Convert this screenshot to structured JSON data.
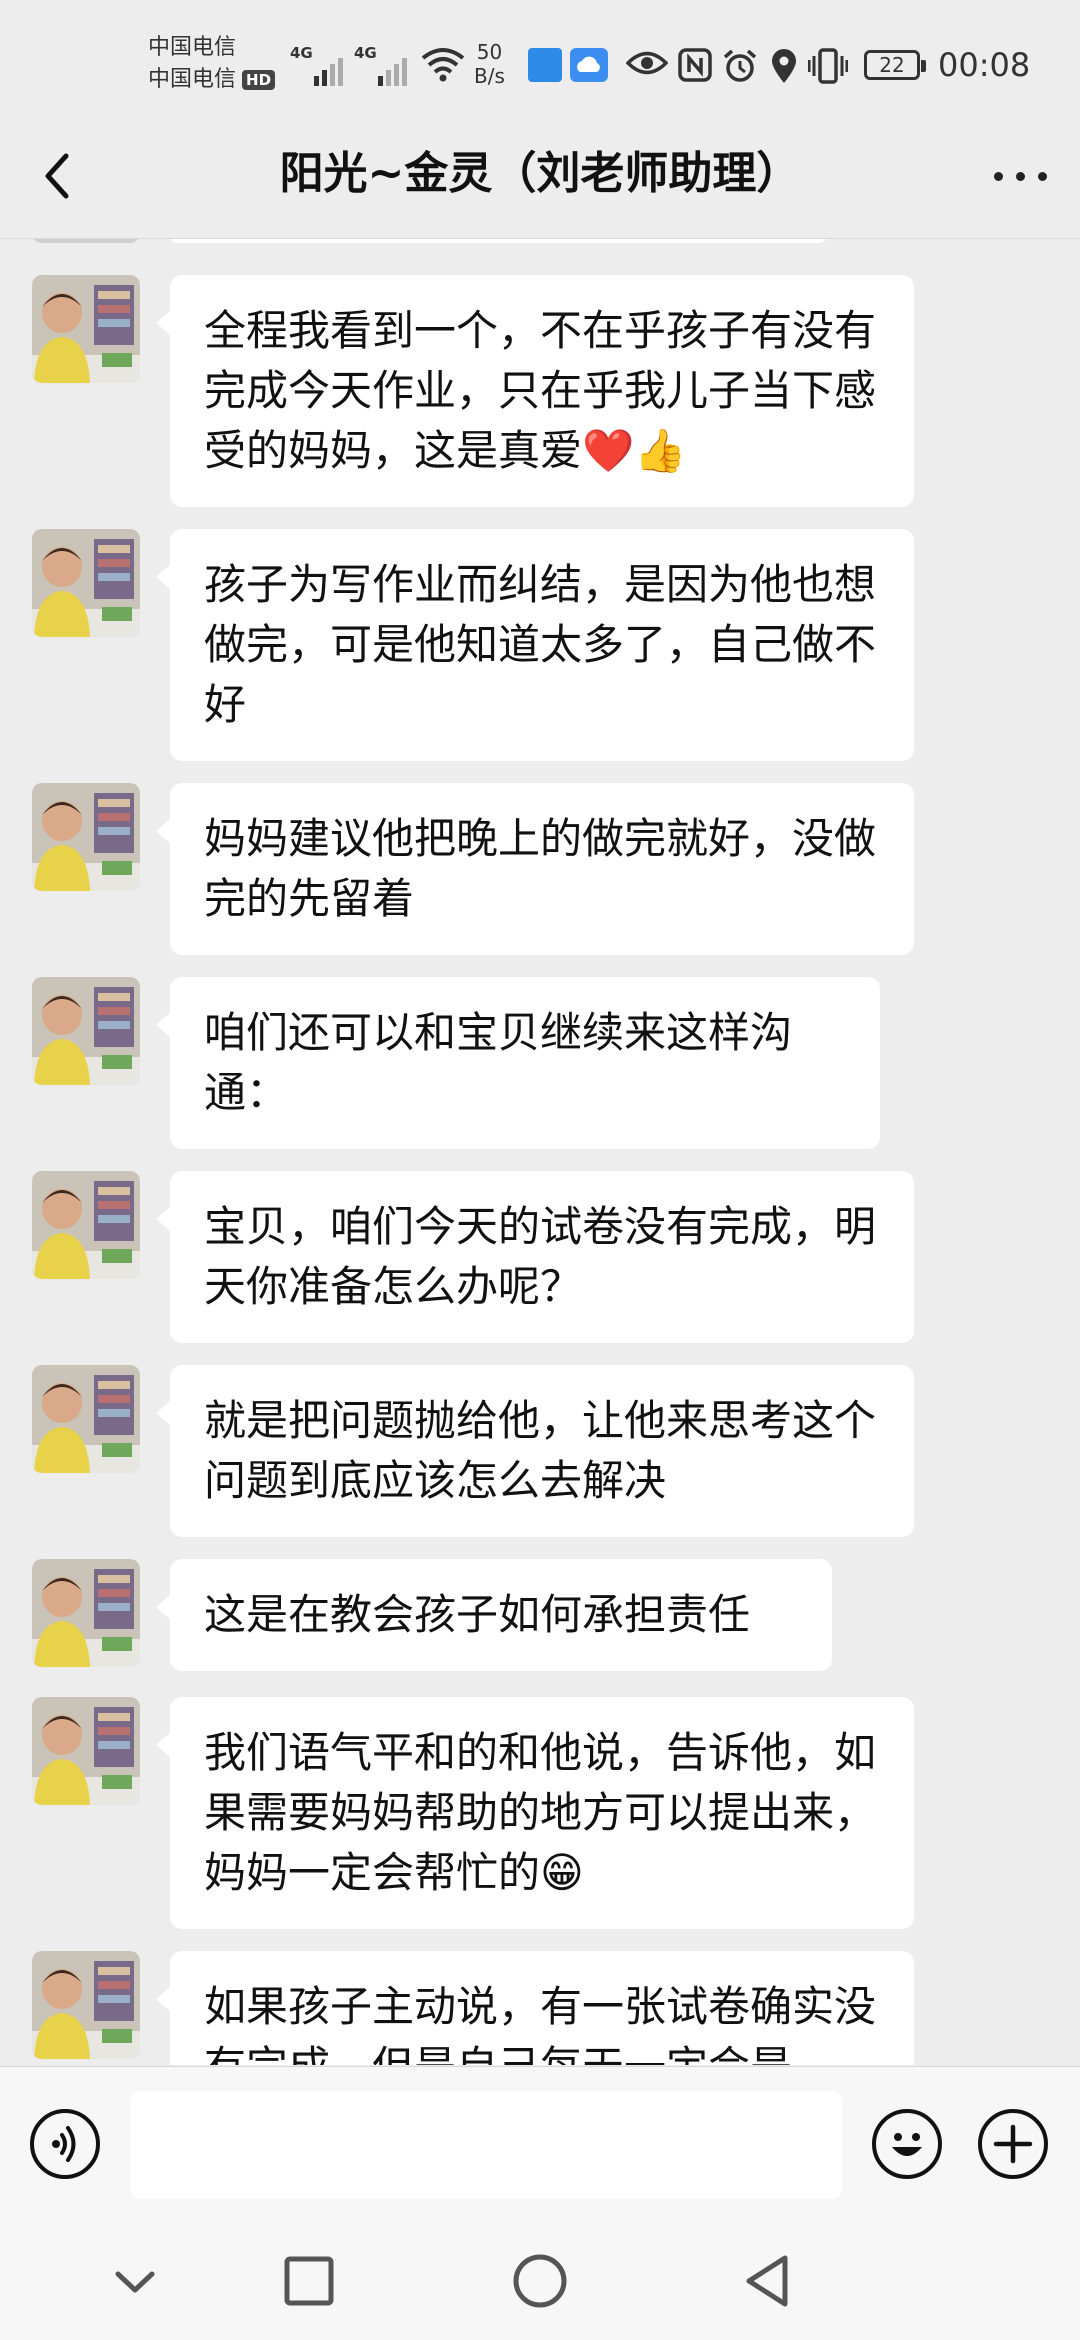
{
  "status_bar": {
    "carrier_1": "中国电信",
    "carrier_2": "中国电信",
    "hd_badge": "HD",
    "signal_1": "4G",
    "signal_2": "4G",
    "speed_value": "50",
    "speed_unit": "B/s",
    "battery": "22",
    "time": "00:08"
  },
  "header": {
    "title": "阳光~金灵（刘老师助理）"
  },
  "messages": [
    {
      "text": "全程我看到一个，不在乎孩子有没有完成今天作业，只在乎我儿子当下感受的妈妈，这是真爱❤️👍"
    },
    {
      "text": "孩子为写作业而纠结，是因为他也想做完，可是他知道太多了，自己做不好"
    },
    {
      "text": "妈妈建议他把晚上的做完就好，没做完的先留着"
    },
    {
      "text": "咱们还可以和宝贝继续来这样沟通："
    },
    {
      "text": "宝贝，咱们今天的试卷没有完成，明天你准备怎么办呢？"
    },
    {
      "text": "就是把问题抛给他，让他来思考这个问题到底应该怎么去解决"
    },
    {
      "text": "这是在教会孩子如何承担责任"
    },
    {
      "text": "我们语气平和的和他说，告诉他，如果需要妈妈帮助的地方可以提出来，妈妈一定会帮忙的😁"
    },
    {
      "text": "如果孩子主动说，有一张试卷确实没有完成，但是自己每天一定会是"
    }
  ],
  "input_bar": {
    "voice_icon": "voice-icon",
    "emoji_icon": "emoji-icon",
    "plus_icon": "plus-icon",
    "message_value": ""
  },
  "nav_bar": {
    "icons": [
      "chevron-down-icon",
      "square-icon",
      "circle-icon",
      "triangle-back-icon"
    ]
  }
}
